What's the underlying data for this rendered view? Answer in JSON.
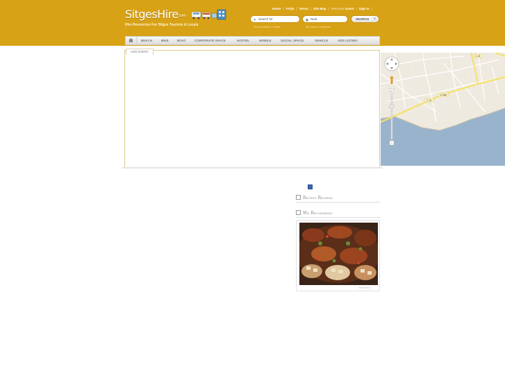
{
  "brand": {
    "name": "SitgesHire",
    "suffix": ".com",
    "tagline": "Hire Resources For Sitges Tourists & Locals"
  },
  "toplinks": {
    "home": "Home",
    "faqs": "FAQs",
    "terms": "Terms",
    "sitemap": "Site Map",
    "welcome": "Welcome",
    "guest": "Guest",
    "signin": "Sign In"
  },
  "search": {
    "for_placeholder": "Search for",
    "near_placeholder": "Near",
    "button_label": "SEARCH",
    "for_hint": "Find products or sites",
    "near_hint": "Zip code or address"
  },
  "nav": {
    "items": [
      "BEACH",
      "BIKE",
      "BOAT",
      "CORPORATE SPACE",
      "HOSTEL",
      "MOBILE",
      "SOCIAL SPACE",
      "VEHICLE",
      "ADD LISTING"
    ]
  },
  "tabs": {
    "add_event": "ADD EVENT"
  },
  "map": {
    "road_labels": [
      "C-31",
      "C-246a",
      "C-31"
    ]
  },
  "sidebar": {
    "recent_reviews": "Recent Reviews",
    "we_recommend": "We Recommend"
  },
  "colors": {
    "header": "#d8a216",
    "nav_text": "#777777",
    "sea": "#99b3cc"
  }
}
